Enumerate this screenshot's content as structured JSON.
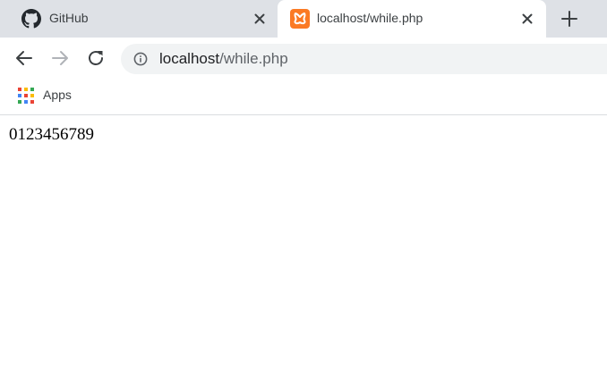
{
  "tabs": [
    {
      "title": "GitHub",
      "icon": "github-icon",
      "active": false
    },
    {
      "title": "localhost/while.php",
      "icon": "xampp-icon",
      "active": true
    }
  ],
  "toolbar": {
    "back_icon": "arrow-left-icon",
    "forward_icon": "arrow-right-icon",
    "reload_icon": "reload-icon"
  },
  "omnibox": {
    "icon": "info-icon",
    "host": "localhost",
    "path": "/while.php"
  },
  "bookmarks": {
    "apps_label": "Apps"
  },
  "page": {
    "output": "0123456789"
  },
  "colors": {
    "tabstrip_bg": "#dee1e6",
    "omnibox_bg": "#f1f3f4",
    "xampp_orange": "#fb7a24"
  }
}
